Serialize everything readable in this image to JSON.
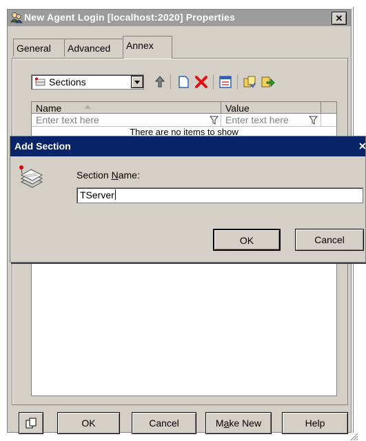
{
  "window": {
    "title": "New Agent Login [localhost:2020] Properties",
    "close_glyph": "✕",
    "tabs": [
      "General",
      "Advanced",
      "Annex"
    ],
    "active_tab": "Annex"
  },
  "toolbar": {
    "combo_value": "Sections",
    "icons": [
      "sections-icon",
      "move-up-icon",
      "new-icon",
      "delete-icon",
      "properties-icon",
      "copy-icon",
      "export-icon"
    ]
  },
  "grid": {
    "columns": [
      "Name",
      "Value"
    ],
    "filter_placeholders": [
      "Enter text here",
      "Enter text here"
    ],
    "empty_message": "There are no items to show"
  },
  "buttons": {
    "ok": "OK",
    "cancel": "Cancel",
    "make_new_pre": "M",
    "make_new_u": "a",
    "make_new_post": "ke New",
    "help": "Help"
  },
  "dialog": {
    "title": "Add Section",
    "close_glyph": "✕",
    "label_pre": "Section ",
    "label_u": "N",
    "label_post": "ame:",
    "input_value": "TServer",
    "ok": "OK",
    "cancel": "Cancel"
  },
  "colors": {
    "dialog_title_bg": "#0a246a",
    "inactive_title_bg": "#9c9c9c",
    "face": "#d4d0c8"
  }
}
